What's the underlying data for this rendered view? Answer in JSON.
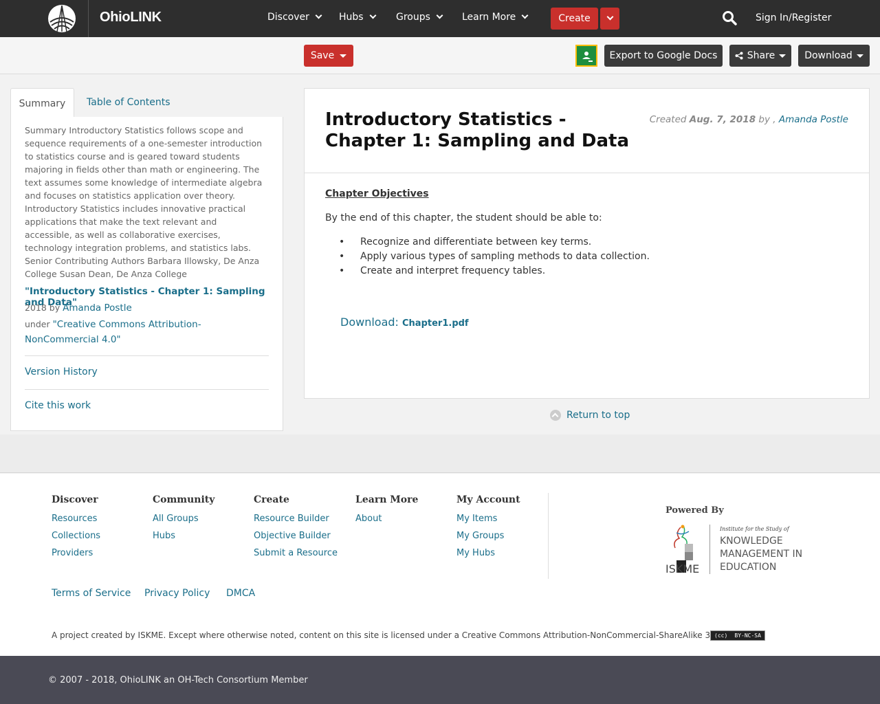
{
  "nav": {
    "brand": "OhioLINK",
    "menus": [
      {
        "label": "Discover"
      },
      {
        "label": "Hubs"
      },
      {
        "label": "Groups"
      },
      {
        "label": "Learn More"
      }
    ],
    "create_label": "Create",
    "signin_label": "Sign In/Register"
  },
  "toolbar": {
    "save_label": "Save",
    "export_label": "Export to Google Docs",
    "share_label": "Share",
    "download_label": "Download"
  },
  "sidebar": {
    "tabs": [
      "Summary",
      "Table of Contents"
    ],
    "summary": "Summary Introductory Statistics follows scope and sequence requirements of a one-semester introduction to statistics course and is geared toward students majoring in fields other than math or engineering. The text assumes some knowledge of intermediate algebra and focuses on statistics application over theory. Introductory Statistics includes innovative practical applications that make the text relevant and accessible, as well as collaborative exercises, technology integration problems, and statistics labs. Senior Contributing Authors Barbara Illowsky, De Anza College Susan Dean, De Anza College",
    "resource_title": "\"Introductory Statistics - Chapter 1: Sampling and Data\"",
    "year_by": "2018 by",
    "author": "Amanda Postle",
    "under": "under",
    "license": "\"Creative Commons Attribution-NonCommercial 4.0\"",
    "version_history": "Version History",
    "cite": "Cite this work"
  },
  "main": {
    "title": "Introductory Statistics - Chapter 1: Sampling and Data",
    "created_label": "Created",
    "created_date": "Aug. 7, 2018",
    "by_label": "by ,",
    "author": "Amanda Postle",
    "objectives_heading": "Chapter Objectives",
    "intro": "By the end of this chapter, the student should be able to:",
    "objectives": [
      "Recognize and differentiate between key terms.",
      "Apply various types of sampling methods to data collection.",
      "Create and interpret frequency tables."
    ],
    "download_label": "Download:",
    "download_file": "Chapter1.pdf"
  },
  "return_top": "Return to top",
  "footer": {
    "columns": [
      {
        "heading": "Discover",
        "links": [
          "Resources",
          "Collections",
          "Providers"
        ]
      },
      {
        "heading": "Community",
        "links": [
          "All Groups",
          "Hubs"
        ]
      },
      {
        "heading": "Create",
        "links": [
          "Resource Builder",
          "Objective Builder",
          "Submit a Resource"
        ]
      },
      {
        "heading": "Learn More",
        "links": [
          "About"
        ]
      },
      {
        "heading": "My Account",
        "links": [
          "My Items",
          "My Groups",
          "My Hubs"
        ]
      }
    ],
    "powered_by": "Powered By",
    "iskme_line1": "Institute for the Study of",
    "iskme_line2": "KNOWLEDGE",
    "iskme_line3": "MANAGEMENT IN",
    "iskme_line4": "EDUCATION",
    "iskme_short": "ISKME",
    "legal": [
      "Terms of Service",
      "Privacy Policy",
      "DMCA"
    ],
    "project": "A project created by ISKME. Except where otherwise noted, content on this site is licensed under a Creative Commons Attribution-NonCommercial-ShareAlike 3.0 License.",
    "cc_badge": "BY-NC-SA",
    "copyright": "© 2007 - 2018, OhioLINK an OH-Tech Consortium Member"
  },
  "colors": {
    "nav_bg": "#2e2e2e",
    "accent_red": "#c9302c",
    "link": "#1a6e8a",
    "bottom_bar": "#4a4a55"
  }
}
